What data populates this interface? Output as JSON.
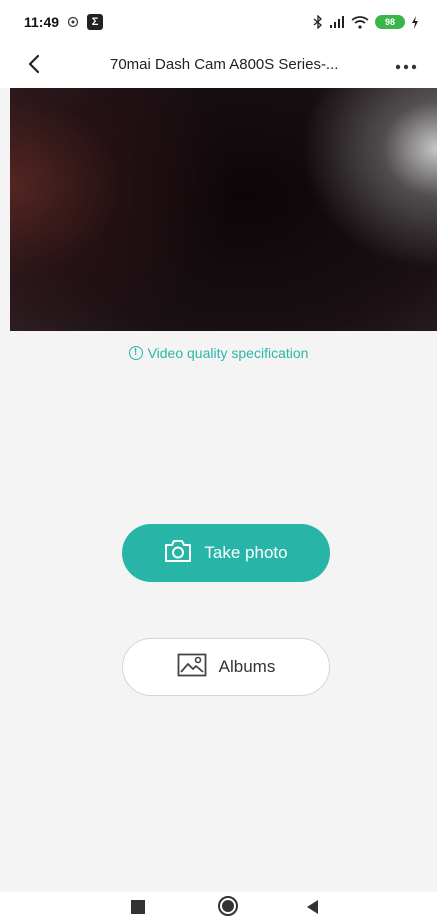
{
  "status_bar": {
    "time": "11:49",
    "sigma_label": "Σ",
    "battery_level": "98"
  },
  "app_bar": {
    "title": "70mai Dash Cam A800S Series-..."
  },
  "spec_link": {
    "icon_glyph": "!",
    "label": "Video quality specification"
  },
  "actions": {
    "take_photo_label": "Take photo",
    "albums_label": "Albums"
  },
  "colors": {
    "accent": "#26b5a6",
    "link": "#2ab7a9",
    "background": "#f4f4f4"
  },
  "icons": {
    "back": "back-arrow-icon",
    "more": "more-dots-icon",
    "camera": "camera-icon",
    "albums": "image-gallery-icon"
  }
}
